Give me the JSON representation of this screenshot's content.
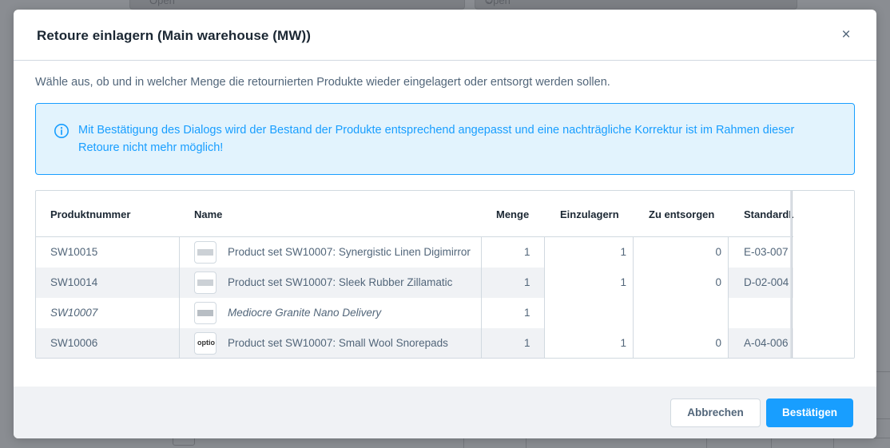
{
  "background": {
    "select_left_value": "Open",
    "select_right_value": "Open"
  },
  "modal": {
    "title": "Retoure einlagern (Main warehouse (MW))",
    "close_symbol": "×",
    "description": "Wähle aus, ob und in welcher Menge die retournierten Produkte wieder eingelagert oder entsorgt werden sollen.",
    "alert": {
      "icon": "info-circle-icon",
      "text": "Mit Bestätigung des Dialogs wird der Bestand der Produkte entsprechend angepasst und eine nachträgliche Korrektur ist im Rahmen dieser Retoure nicht mehr möglich!"
    },
    "table": {
      "columns": [
        "Produktnummer",
        "Name",
        "Menge",
        "Einzulagern",
        "Zu entsorgen",
        "StandardL"
      ],
      "rows": [
        {
          "number": "SW10015",
          "thumb": "temporibus",
          "name": "Product set SW10007: Synergistic Linen Digimirror",
          "menge": "1",
          "einzulagern": "1",
          "zu_entsorgen": "0",
          "standard": "E-03-007"
        },
        {
          "number": "SW10014",
          "thumb": "temporibus",
          "name": "Product set SW10007: Sleek Rubber Zillamatic",
          "menge": "1",
          "einzulagern": "1",
          "zu_entsorgen": "0",
          "standard": "D-02-004"
        },
        {
          "number": "SW10007",
          "thumb": "voluptatem",
          "name": "Mediocre Granite Nano Delivery",
          "menge": "1",
          "einzulagern": "",
          "zu_entsorgen": "",
          "standard": ""
        },
        {
          "number": "SW10006",
          "thumb": "optio",
          "name": "Product set SW10007: Small Wool Snorepads",
          "menge": "1",
          "einzulagern": "1",
          "zu_entsorgen": "0",
          "standard": "A-04-006"
        }
      ]
    },
    "footer": {
      "cancel_label": "Abbrechen",
      "confirm_label": "Bestätigen"
    }
  },
  "colors": {
    "accent": "#189eff",
    "alert_bg": "#e2f3fd",
    "title": "#1b2733",
    "text": "#52667a"
  }
}
